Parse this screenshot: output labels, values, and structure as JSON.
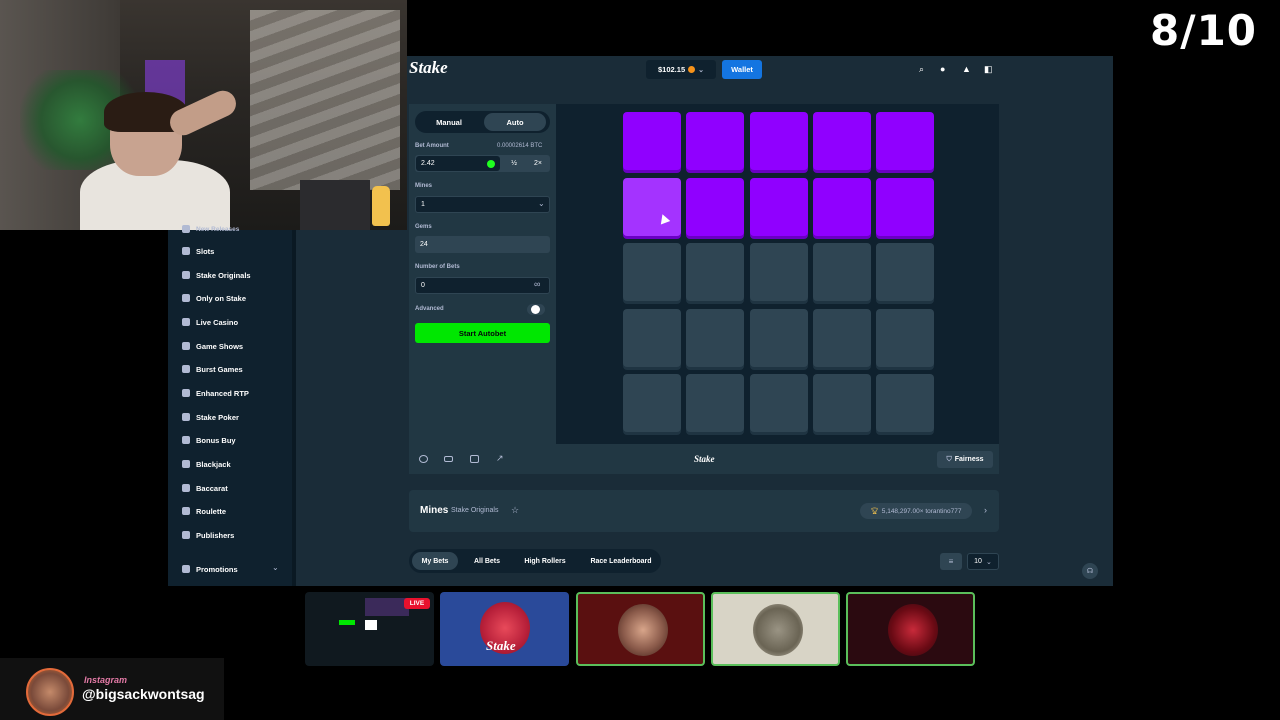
{
  "overlay": {
    "counter": "8/10",
    "instagram_label": "Instagram",
    "instagram_handle": "@bigsackwontsag",
    "live_badge": "LIVE"
  },
  "header": {
    "logo": "Stake",
    "balance": "$102.15",
    "wallet_label": "Wallet",
    "icons": [
      "search-icon",
      "user-icon",
      "bell-icon",
      "sidebar-toggle-icon"
    ]
  },
  "sidebar": {
    "items": [
      {
        "label": "New Releases",
        "icon": "star-icon"
      },
      {
        "label": "Slots",
        "icon": "slots-icon"
      },
      {
        "label": "Stake Originals",
        "icon": "stake-originals-icon"
      },
      {
        "label": "Only on Stake",
        "icon": "only-on-stake-icon"
      },
      {
        "label": "Live Casino",
        "icon": "live-casino-icon"
      },
      {
        "label": "Game Shows",
        "icon": "game-shows-icon"
      },
      {
        "label": "Burst Games",
        "icon": "burst-games-icon"
      },
      {
        "label": "Enhanced RTP",
        "icon": "enhanced-rtp-icon"
      },
      {
        "label": "Stake Poker",
        "icon": "poker-icon"
      },
      {
        "label": "Bonus Buy",
        "icon": "bonus-buy-icon"
      },
      {
        "label": "Blackjack",
        "icon": "blackjack-icon"
      },
      {
        "label": "Baccarat",
        "icon": "baccarat-icon"
      },
      {
        "label": "Roulette",
        "icon": "roulette-icon"
      },
      {
        "label": "Publishers",
        "icon": "publishers-icon"
      }
    ],
    "promotions": "Promotions"
  },
  "controls": {
    "tab_manual": "Manual",
    "tab_auto": "Auto",
    "active_tab": "Auto",
    "bet_amount_label": "Bet Amount",
    "bet_amount_btc": "0.00002614 BTC",
    "bet_amount_value": "2.42",
    "half_label": "½",
    "double_label": "2×",
    "mines_label": "Mines",
    "mines_value": "1",
    "gems_label": "Gems",
    "gems_value": "24",
    "number_of_bets_label": "Number of Bets",
    "number_of_bets_value": "0",
    "infinity_symbol": "∞",
    "advanced_label": "Advanced",
    "advanced_on": false,
    "start_autobet": "Start Autobet"
  },
  "board": {
    "rows": [
      [
        "gem",
        "gem",
        "gem",
        "gem",
        "gem"
      ],
      [
        "gem-hover",
        "gem",
        "gem",
        "gem",
        "gem"
      ],
      [
        "empty",
        "empty",
        "empty",
        "empty",
        "empty"
      ],
      [
        "empty",
        "empty",
        "empty",
        "empty",
        "empty"
      ],
      [
        "empty",
        "empty",
        "empty",
        "empty",
        "empty"
      ]
    ],
    "gem_color": "#9000ff",
    "tile_color": "#2f4553"
  },
  "game_footer": {
    "icons": [
      "settings-icon",
      "theatre-mode-icon",
      "stats-icon",
      "popout-icon"
    ],
    "logo": "Stake",
    "fairness_label": "Fairness"
  },
  "game_info": {
    "title": "Mines",
    "subtitle": "Stake Originals",
    "big_win": "5,148,297.00× torantino777"
  },
  "bets_tabs": {
    "my_bets": "My Bets",
    "all_bets": "All Bets",
    "high_rollers": "High Rollers",
    "race_leaderboard": "Race Leaderboard",
    "page_size": "10"
  },
  "colors": {
    "background": "#1a2c38",
    "accent_green": "#00e701",
    "wallet_blue": "#1475e1",
    "gem_purple": "#9000ff"
  }
}
